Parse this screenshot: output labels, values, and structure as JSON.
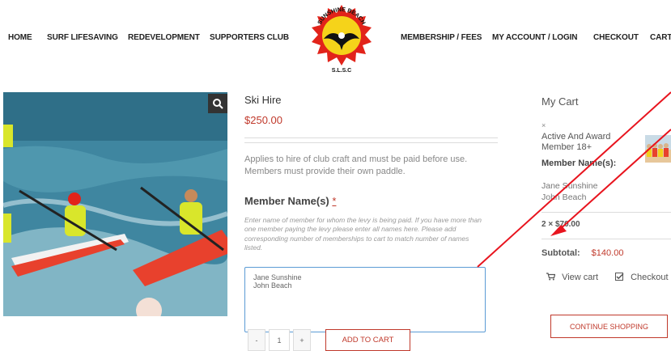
{
  "nav": {
    "home": "HOME",
    "surf_lifesaving": "SURF LIFESAVING",
    "redevelopment": "REDEVELOPMENT",
    "supporters_club": "SUPPORTERS CLUB",
    "membership_fees": "MEMBERSHIP / FEES",
    "my_account": "MY ACCOUNT / LOGIN",
    "checkout": "CHECKOUT",
    "cart": "CART"
  },
  "logo": {
    "top_text": "SUNSHINE BEACH",
    "bottom_text": "S.L.S.C"
  },
  "product": {
    "title": "Ski Hire",
    "price": "$250.00",
    "description": "Applies to hire of club craft and must be paid before use. Members must provide their own paddle.",
    "member_label": "Member Name(s)",
    "required_mark": "*",
    "hint": "Enter name of member for whom the levy is being paid. If you have more than one member paying the levy please enter all names here. Please add corresponding number of memberships to cart to match number of names listed.",
    "names_value": "Jane Sunshine\nJohn Beach",
    "qty_minus": "-",
    "qty_value": "1",
    "qty_plus": "+",
    "add_to_cart": "ADD TO CART"
  },
  "cart": {
    "title": "My Cart",
    "remove": "×",
    "item_name": "Active And Award Member 18+",
    "member_names_label": "Member Name(s):",
    "name1": "Jane Sunshine",
    "name2": "John Beach",
    "qty_line": "2 × $70.00",
    "subtotal_label": "Subtotal:",
    "subtotal_value": "$140.00",
    "view_cart": "View cart",
    "checkout": "Checkout",
    "continue": "CONTINUE SHOPPING"
  },
  "colors": {
    "accent": "#c0392b",
    "focus_border": "#5b9bd5",
    "annotation": "#e8141e"
  }
}
